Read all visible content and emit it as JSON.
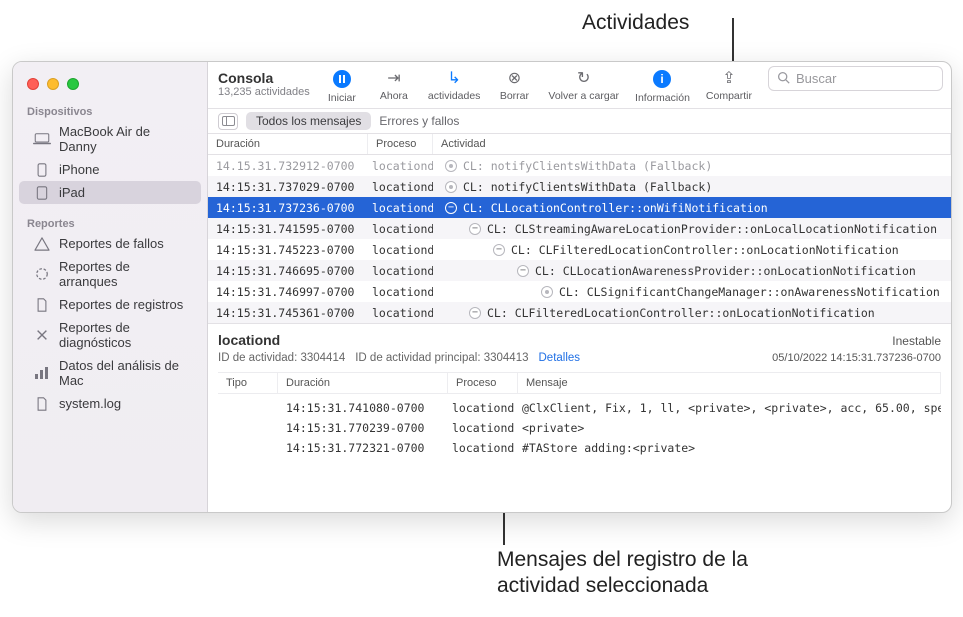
{
  "callouts": {
    "top": "Actividades",
    "bottom_line1": "Mensajes del registro de la",
    "bottom_line2": "actividad seleccionada"
  },
  "window": {
    "title": "Consola",
    "subtitle": "13,235 actividades"
  },
  "toolbar": {
    "iniciar": "Iniciar",
    "ahora": "Ahora",
    "actividades": "actividades",
    "borrar": "Borrar",
    "volver": "Volver a cargar",
    "info": "Información",
    "compartir": "Compartir",
    "search_placeholder": "Buscar"
  },
  "filter": {
    "todos": "Todos los mensajes",
    "errores": "Errores y fallos"
  },
  "sidebar": {
    "dispositivos_head": "Dispositivos",
    "mac": "MacBook Air de Danny",
    "iphone": "iPhone",
    "ipad": "iPad",
    "reportes_head": "Reportes",
    "fallos": "Reportes de fallos",
    "arranques": "Reportes de arranques",
    "registros": "Reportes de registros",
    "diagnosticos": "Reportes de diagnósticos",
    "analisis": "Datos del análisis de Mac",
    "systemlog": "system.log"
  },
  "columns": {
    "dur": "Duración",
    "proc": "Proceso",
    "act": "Actividad"
  },
  "rows": [
    {
      "dur": "14.15.31.732912-0700",
      "proc": "locationd",
      "indent": 0,
      "node": "dot",
      "act": "CL: notifyClientsWithData (Fallback)",
      "partial": true
    },
    {
      "dur": "14:15:31.737029-0700",
      "proc": "locationd",
      "indent": 0,
      "node": "dot",
      "act": "CL: notifyClientsWithData (Fallback)"
    },
    {
      "dur": "14:15:31.737236-0700",
      "proc": "locationd",
      "indent": 0,
      "node": "minus",
      "act": "CL: CLLocationController::onWifiNotification",
      "selected": true
    },
    {
      "dur": "14:15:31.741595-0700",
      "proc": "locationd",
      "indent": 1,
      "node": "minus",
      "act": "CL: CLStreamingAwareLocationProvider::onLocalLocationNotification"
    },
    {
      "dur": "14:15:31.745223-0700",
      "proc": "locationd",
      "indent": 2,
      "node": "minus",
      "act": "CL: CLFilteredLocationController::onLocationNotification"
    },
    {
      "dur": "14:15:31.746695-0700",
      "proc": "locationd",
      "indent": 3,
      "node": "minus",
      "act": "CL: CLLocationAwarenessProvider::onLocationNotification"
    },
    {
      "dur": "14:15:31.746997-0700",
      "proc": "locationd",
      "indent": 4,
      "node": "dot",
      "act": "CL: CLSignificantChangeManager::onAwarenessNotification"
    },
    {
      "dur": "14:15:31.745361-0700",
      "proc": "locationd",
      "indent": 1,
      "node": "minus",
      "act": "CL: CLFilteredLocationController::onLocationNotification"
    }
  ],
  "detail": {
    "proc": "locationd",
    "status": "Inestable",
    "id_label": "ID de actividad: 3304414",
    "id_parent": "ID de actividad principal: 3304413",
    "detalles": "Detalles",
    "timestamp": "05/10/2022 14:15:31.737236-0700",
    "cols": {
      "tipo": "Tipo",
      "dur": "Duración",
      "proc": "Proceso",
      "msg": "Mensaje"
    },
    "rows": [
      {
        "dur": "14:15:31.741080-0700",
        "proc": "locationd",
        "msg": "@ClxClient, Fix, 1, ll, <private>, <private>, acc, 65.00, spe"
      },
      {
        "dur": "14:15:31.770239-0700",
        "proc": "locationd",
        "msg": "<private>"
      },
      {
        "dur": "14:15:31.772321-0700",
        "proc": "locationd",
        "msg": "#TAStore adding:<private>"
      }
    ]
  }
}
